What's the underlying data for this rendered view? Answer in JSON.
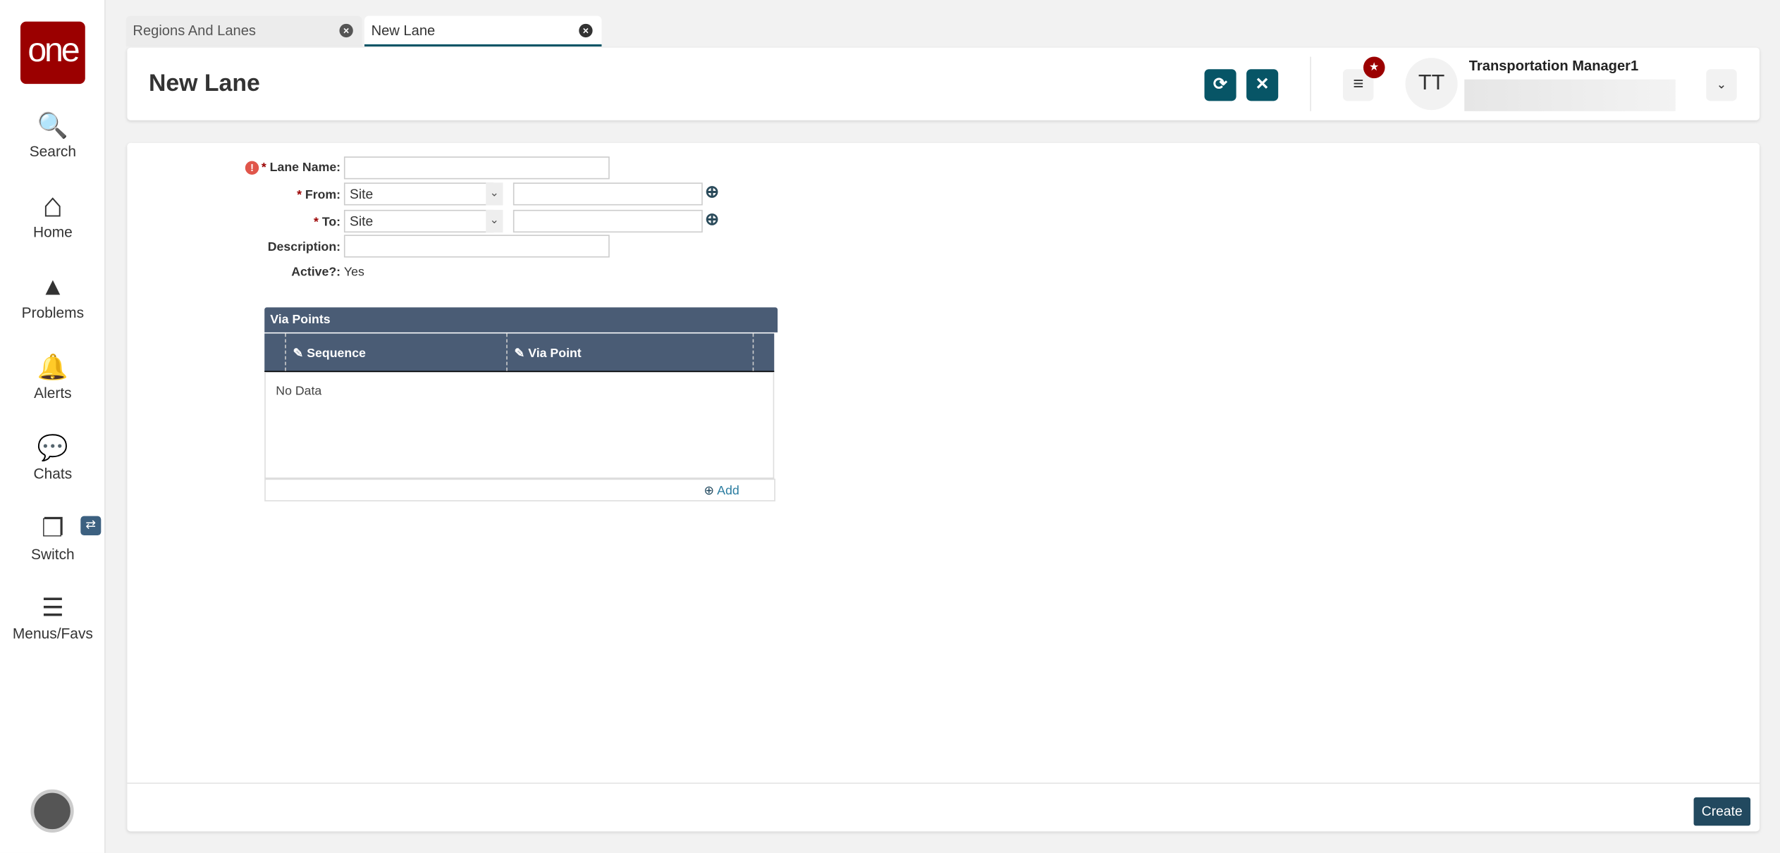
{
  "sidebar": {
    "logo": "one",
    "items": [
      {
        "label": "Search",
        "icon": "search-icon",
        "glyph": "🔍"
      },
      {
        "label": "Home",
        "icon": "home-icon",
        "glyph": "⌂"
      },
      {
        "label": "Problems",
        "icon": "warning-icon",
        "glyph": "▲"
      },
      {
        "label": "Alerts",
        "icon": "bell-icon",
        "glyph": "🔔"
      },
      {
        "label": "Chats",
        "icon": "chat-icon",
        "glyph": "💬"
      },
      {
        "label": "Switch",
        "icon": "switch-icon",
        "glyph": "❐"
      },
      {
        "label": "Menus/Favs",
        "icon": "menu-icon",
        "glyph": "☰"
      }
    ]
  },
  "tabs": [
    {
      "label": "Regions And Lanes",
      "active": false
    },
    {
      "label": "New Lane",
      "active": true
    }
  ],
  "header": {
    "title": "New Lane",
    "user_initials": "TT",
    "user_name": "Transportation Manager1"
  },
  "form": {
    "lane_name_label": "Lane Name:",
    "lane_name_value": "",
    "from_label": "From:",
    "from_type": "Site",
    "from_value": "",
    "to_label": "To:",
    "to_type": "Site",
    "to_value": "",
    "description_label": "Description:",
    "description_value": "",
    "active_label": "Active?:",
    "active_value": "Yes",
    "required_mark": "*"
  },
  "via_points": {
    "title": "Via Points",
    "columns": [
      "Sequence",
      "Via Point"
    ],
    "empty_text": "No Data",
    "add_label": "Add"
  },
  "footer": {
    "create_label": "Create"
  },
  "colors": {
    "brand": "#9b0000",
    "accent": "#075566",
    "grid_header": "#4a5c75"
  }
}
